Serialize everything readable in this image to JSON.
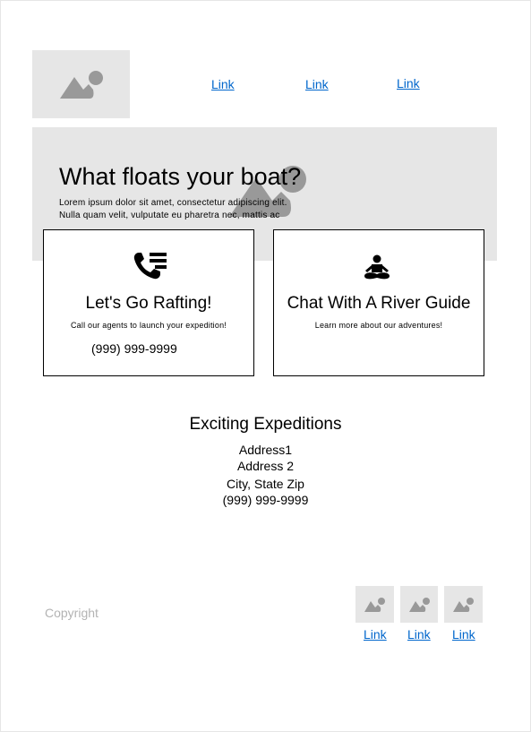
{
  "header": {
    "nav_links": [
      "Link",
      "Link",
      "Link"
    ]
  },
  "hero": {
    "title": "What floats your boat?",
    "body_line1": "Lorem ipsum dolor sit amet, consectetur adipiscing elit.",
    "body_line2": "Nulla quam velit, vulputate eu pharetra nec, mattis ac"
  },
  "cards": [
    {
      "icon": "phone-list-icon",
      "title": "Let's Go Rafting!",
      "description": "Call our agents to launch your expedition!",
      "phone": "(999) 999-9999"
    },
    {
      "icon": "meditation-person-icon",
      "title": "Chat With A River Guide",
      "description": "Learn more about our adventures!"
    }
  ],
  "address": {
    "name": "Exciting Expeditions",
    "line1": "Address1",
    "line2": "Address 2",
    "city_state_zip": "City, State Zip",
    "phone": "(999) 999-9999"
  },
  "footer": {
    "copyright": "Copyright",
    "links": [
      "Link",
      "Link",
      "Link"
    ]
  },
  "colors": {
    "placeholder_bg": "#e6e6e6",
    "placeholder_icon": "#999999",
    "link": "#0066cc",
    "muted_text": "#b3b3b3"
  }
}
